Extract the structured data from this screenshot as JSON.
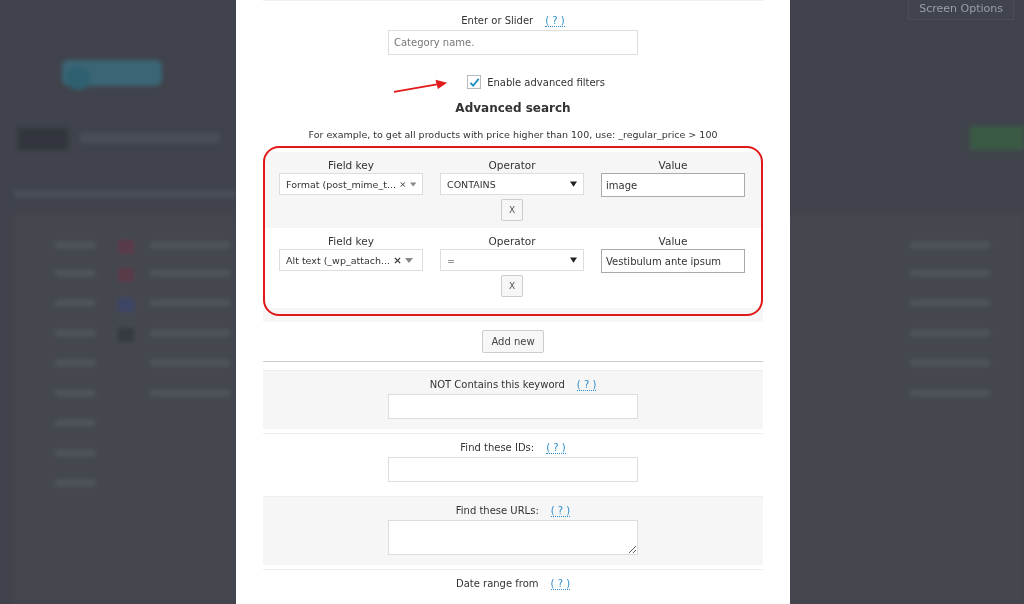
{
  "background": {
    "screen_options": "Screen Options"
  },
  "modal": {
    "category_filter": {
      "label": "Enter or Slider",
      "help": "( ? )",
      "placeholder": "Category name."
    },
    "advanced_toggle": {
      "label": "Enable advanced filters",
      "checked": true
    },
    "advanced": {
      "title": "Advanced search",
      "hint": "For example, to get all products with price higher than 100, use: _regular_price > 100",
      "rows": [
        {
          "field_key_label": "Field key",
          "field_key": "Format (post_mime_t...",
          "operator_label": "Operator",
          "operator": "CONTAINS",
          "value_label": "Value",
          "value": "image",
          "remove": "X"
        },
        {
          "field_key_label": "Field key",
          "field_key": "Alt text (_wp_attach...",
          "operator_label": "Operator",
          "operator": "=",
          "value_label": "Value",
          "value": "Vestibulum ante ipsum",
          "remove": "X"
        }
      ],
      "add_button": "Add new"
    },
    "fields": [
      {
        "label": "NOT Contains this keyword",
        "help": "( ? )",
        "kind": "input"
      },
      {
        "label": "Find these IDs:",
        "help": "( ? )",
        "kind": "input"
      },
      {
        "label": "Find these URLs:",
        "help": "( ? )",
        "kind": "textarea"
      },
      {
        "label": "Date range from",
        "help": "( ? )",
        "kind": "heading"
      }
    ]
  }
}
